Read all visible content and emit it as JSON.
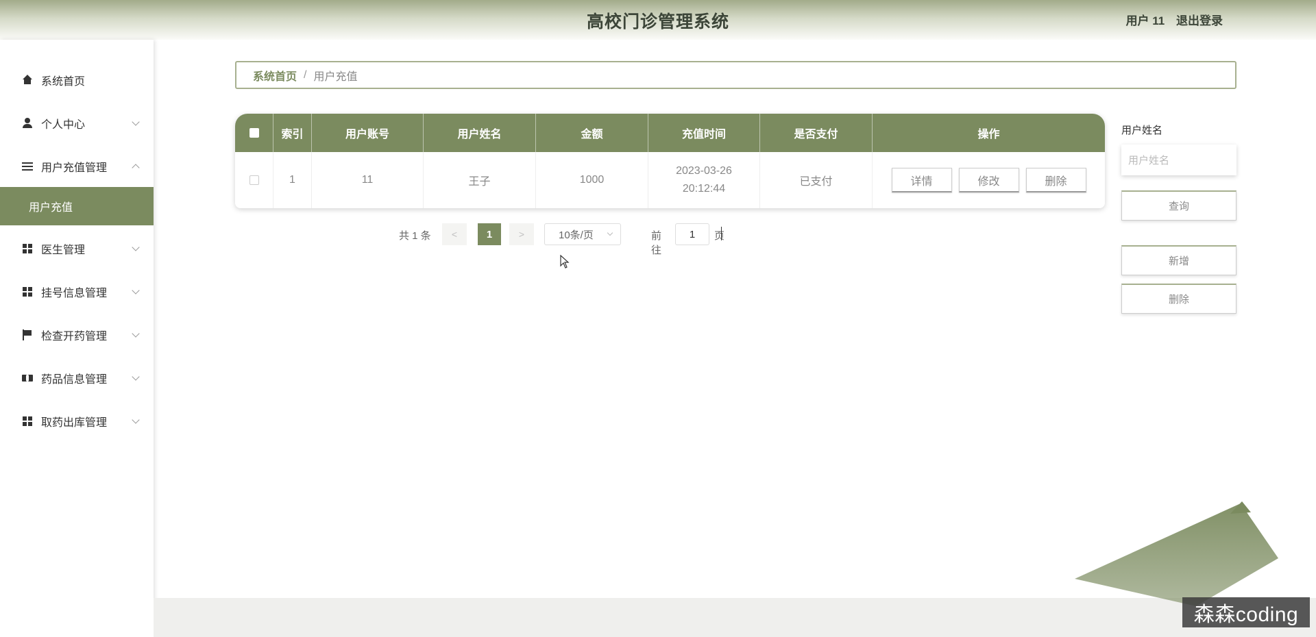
{
  "header": {
    "title": "高校门诊管理系统",
    "user_label": "用户 11",
    "logout_label": "退出登录"
  },
  "sidebar": {
    "items": [
      {
        "label": "系统首页",
        "icon": "home-icon"
      },
      {
        "label": "个人中心",
        "icon": "user-icon"
      },
      {
        "label": "用户充值管理",
        "icon": "list-icon"
      },
      {
        "label": "医生管理",
        "icon": "grid-icon"
      },
      {
        "label": "挂号信息管理",
        "icon": "grid-icon"
      },
      {
        "label": "检查开药管理",
        "icon": "flag-icon"
      },
      {
        "label": "药品信息管理",
        "icon": "ticket-icon"
      },
      {
        "label": "取药出库管理",
        "icon": "grid-icon"
      }
    ],
    "submenu_active": "用户充值"
  },
  "breadcrumb": {
    "home": "系统首页",
    "separator": "/",
    "current": "用户充值"
  },
  "table": {
    "columns": [
      "索引",
      "用户账号",
      "用户姓名",
      "金额",
      "充值时间",
      "是否支付",
      "操作"
    ],
    "rows": [
      {
        "index": "1",
        "account": "11",
        "name": "王子",
        "amount": "1000",
        "time": "2023-03-26 20:12:44",
        "paid": "已支付"
      }
    ],
    "actions": {
      "detail": "详情",
      "edit": "修改",
      "delete": "删除"
    }
  },
  "pagination": {
    "total": "共 1 条",
    "prev": "<",
    "next": ">",
    "current_page": "1",
    "page_size": "10条/页",
    "goto_label": "前往",
    "goto_value": "1",
    "page_suffix": "页"
  },
  "search_panel": {
    "label": "用户姓名",
    "placeholder": "用户姓名",
    "query_button": "查询",
    "add_button": "新增",
    "delete_button": "删除"
  },
  "watermark": "森森coding",
  "colors": {
    "accent": "#7b8b5f",
    "header_gradient_top": "#a2ab8a",
    "border": "#a7b08f"
  }
}
